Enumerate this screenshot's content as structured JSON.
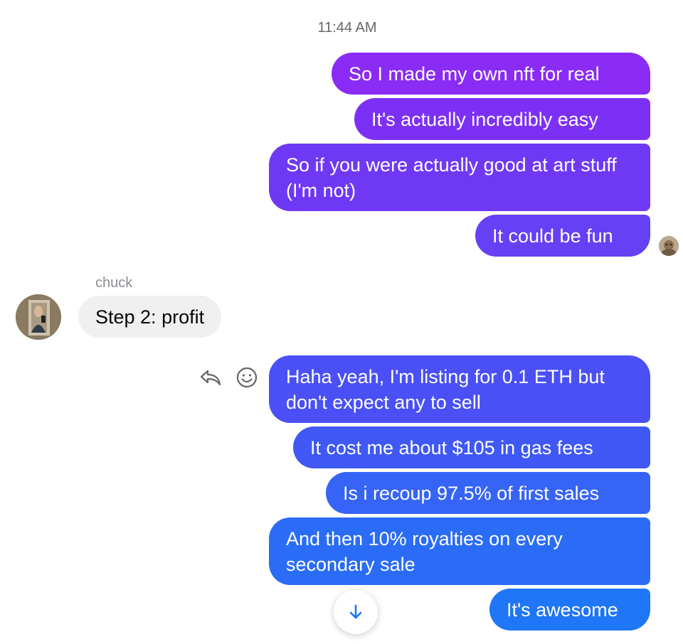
{
  "timestamp": "11:44 AM",
  "sent_group_1": [
    {
      "text": "So I made my own nft for real",
      "color": "#8a2cf5"
    },
    {
      "text": "It's actually incredibly easy",
      "color": "#7d30f5"
    },
    {
      "text": "So if you were actually good at art stuff (I'm not)",
      "color": "#6f38f5"
    },
    {
      "text": "It could be fun",
      "color": "#6540f5"
    }
  ],
  "received": {
    "sender_name": "chuck",
    "text": "Step 2: profit",
    "avatar_icon": "profile-photo"
  },
  "sent_group_2": [
    {
      "text": "Haha yeah, I'm listing for 0.1 ETH but don't expect any to sell",
      "color": "#4a50f6"
    },
    {
      "text": "It cost me about $105 in gas fees",
      "color": "#3f58f6"
    },
    {
      "text": "Is i recoup 97.5% of first sales",
      "color": "#3664f6"
    },
    {
      "text": "And then 10% royalties on every secondary sale",
      "color": "#2a6cf6"
    },
    {
      "text": "It's awesome",
      "color": "#1f76f6"
    }
  ],
  "icons": {
    "reply": "reply-icon",
    "react": "emoji-icon",
    "scroll": "arrow-down-icon",
    "read_receipt": "avatar-read-receipt"
  },
  "colors": {
    "accent": "#1877f2",
    "received_bubble": "#f0f0f0"
  }
}
